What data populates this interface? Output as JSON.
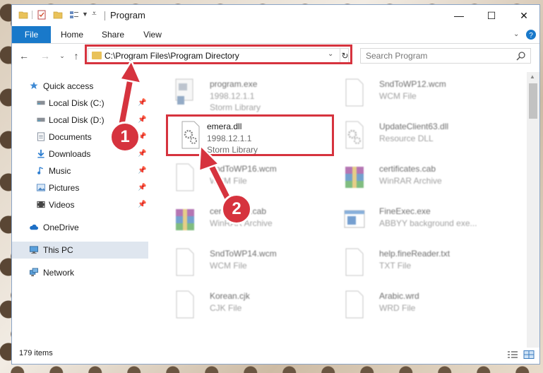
{
  "window": {
    "title": "Program",
    "controls": [
      "—",
      "☐",
      "✕"
    ]
  },
  "ribbon": {
    "tabs": [
      {
        "label": "File",
        "active": true
      },
      {
        "label": "Home"
      },
      {
        "label": "Share"
      },
      {
        "label": "View"
      }
    ]
  },
  "navigation": {
    "address": "C:\\Program Files\\Program Directory",
    "search_placeholder": "Search Program"
  },
  "sidebar": {
    "items": [
      {
        "label": "Quick access",
        "icon": "star-icon"
      },
      {
        "label": "Local Disk (C:)",
        "icon": "drive-icon",
        "pinned": true
      },
      {
        "label": "Local Disk (D:)",
        "icon": "drive-icon",
        "pinned": true
      },
      {
        "label": "Documents",
        "icon": "documents-icon",
        "pinned": true
      },
      {
        "label": "Downloads",
        "icon": "download-icon",
        "pinned": true
      },
      {
        "label": "Music",
        "icon": "music-icon",
        "pinned": true
      },
      {
        "label": "Pictures",
        "icon": "pictures-icon",
        "pinned": true
      },
      {
        "label": "Videos",
        "icon": "videos-icon",
        "pinned": true
      },
      {
        "label": "OneDrive",
        "icon": "cloud-icon"
      },
      {
        "label": "This PC",
        "icon": "computer-icon",
        "selected": true
      },
      {
        "label": "Network",
        "icon": "network-icon"
      }
    ]
  },
  "files": [
    {
      "name": "program.exe",
      "meta1": "1998.12.1.1",
      "meta2": "Storm Library",
      "icon": "exe-icon"
    },
    {
      "name": "SndToWP12.wcm",
      "meta1": "WCM File",
      "meta2": "",
      "icon": "blank-file-icon"
    },
    {
      "name": "emera.dll",
      "meta1": "1998.12.1.1",
      "meta2": "Storm Library",
      "icon": "dll-gear-icon",
      "highlighted": true
    },
    {
      "name": "UpdateClient63.dll",
      "meta1": "Resource DLL",
      "meta2": "",
      "icon": "dll-gear-icon"
    },
    {
      "name": "SndToWP16.wcm",
      "meta1": "WCM File",
      "meta2": "",
      "icon": "blank-file-icon"
    },
    {
      "name": "certificates.cab",
      "meta1": "WinRAR Archive",
      "meta2": "",
      "icon": "archive-icon"
    },
    {
      "name": "certificates.cab",
      "meta1": "WinRAR Archive",
      "meta2": "",
      "icon": "archive-icon"
    },
    {
      "name": "FineExec.exe",
      "meta1": "ABBYY background exe...",
      "meta2": "",
      "icon": "window-exe-icon"
    },
    {
      "name": "SndToWP14.wcm",
      "meta1": "WCM File",
      "meta2": "",
      "icon": "blank-file-icon"
    },
    {
      "name": "help.fineReader.txt",
      "meta1": "TXT File",
      "meta2": "",
      "icon": "blank-file-icon"
    },
    {
      "name": "Korean.cjk",
      "meta1": "CJK File",
      "meta2": "",
      "icon": "blank-file-icon"
    },
    {
      "name": "Arabic.wrd",
      "meta1": "WRD File",
      "meta2": "",
      "icon": "blank-file-icon"
    }
  ],
  "status": {
    "item_count": "179 items"
  },
  "annotations": {
    "badge1": "1",
    "badge2": "2",
    "highlight_color": "#d6333e"
  }
}
